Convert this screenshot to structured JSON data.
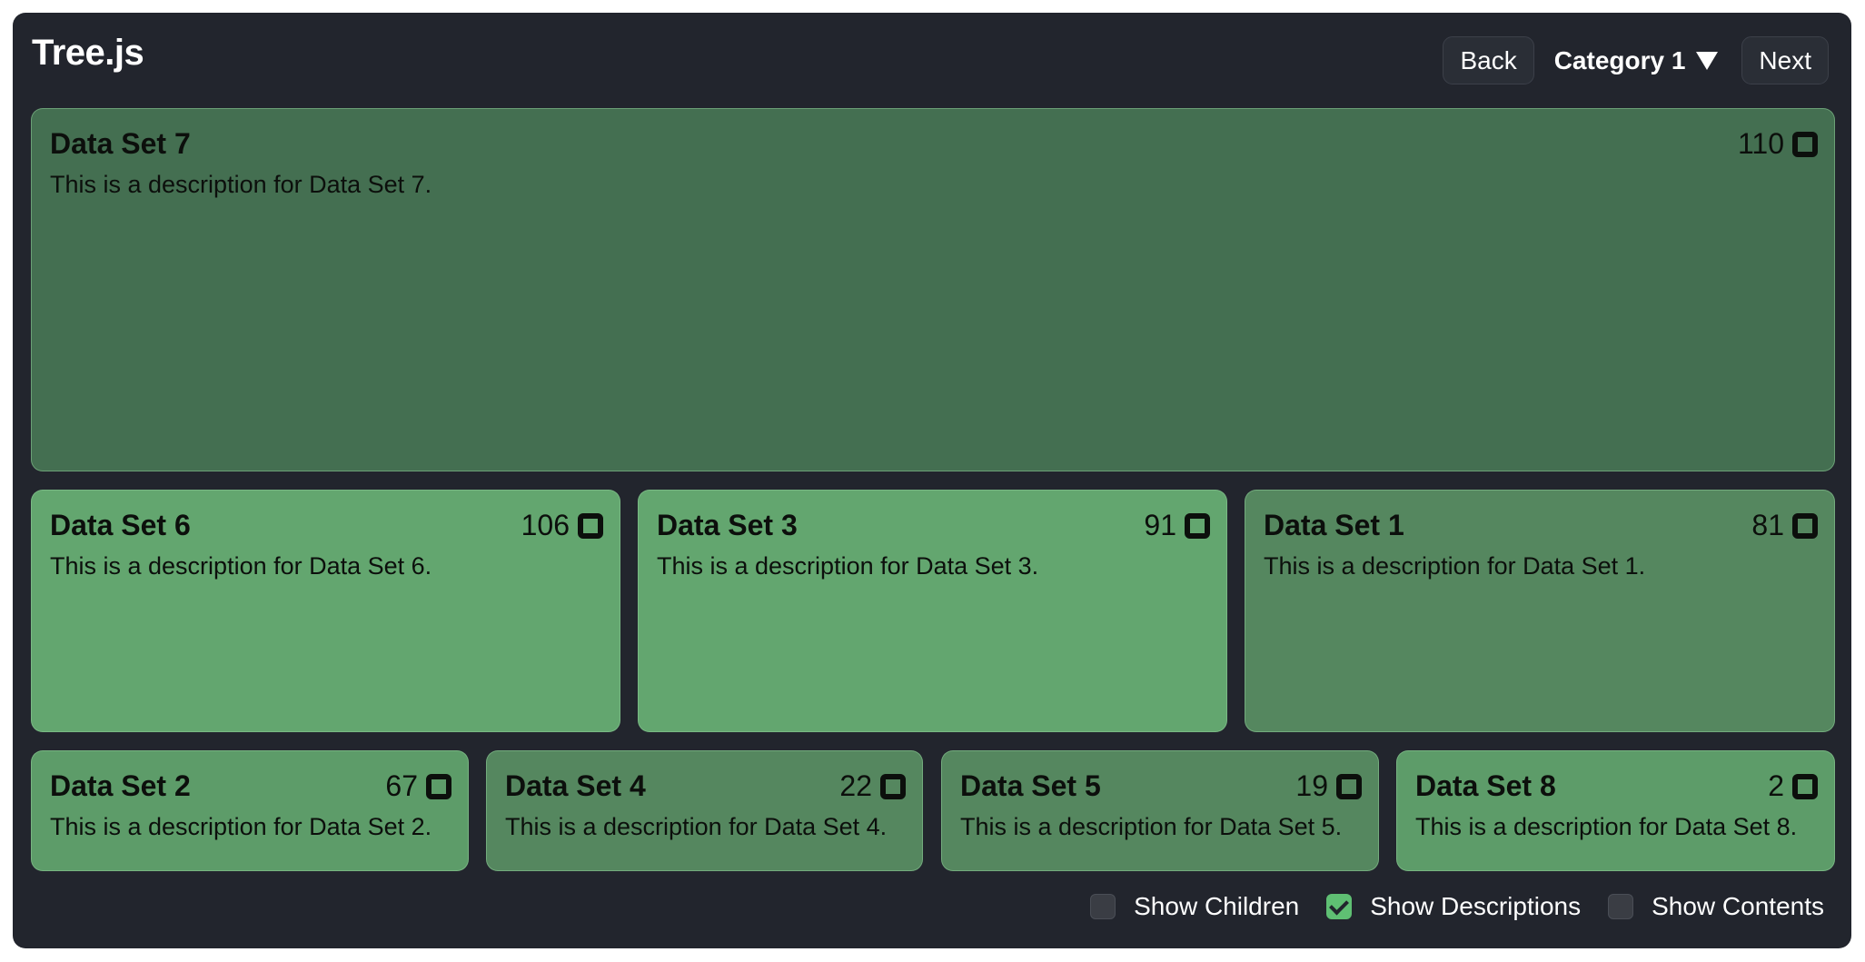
{
  "header": {
    "title": "Tree.js",
    "back_label": "Back",
    "category_label": "Category 1",
    "next_label": "Next"
  },
  "tiles": [
    {
      "title": "Data Set 7",
      "count": "110",
      "description": "This is a description for Data Set 7.",
      "color": "#446f51"
    },
    {
      "title": "Data Set 6",
      "count": "106",
      "description": "This is a description for Data Set 6.",
      "color": "#63a66f"
    },
    {
      "title": "Data Set 3",
      "count": "91",
      "description": "This is a description for Data Set 3.",
      "color": "#63a66f"
    },
    {
      "title": "Data Set 1",
      "count": "81",
      "description": "This is a description for Data Set 1.",
      "color": "#55875f"
    },
    {
      "title": "Data Set 2",
      "count": "67",
      "description": "This is a description for Data Set 2.",
      "color": "#5d9c69"
    },
    {
      "title": "Data Set 4",
      "count": "22",
      "description": "This is a description for Data Set 4.",
      "color": "#55875f"
    },
    {
      "title": "Data Set 5",
      "count": "19",
      "description": "This is a description for Data Set 5.",
      "color": "#55875f"
    },
    {
      "title": "Data Set 8",
      "count": "2",
      "description": "This is a description for Data Set 8.",
      "color": "#5d9c69"
    }
  ],
  "options": {
    "show_children": {
      "label": "Show Children",
      "checked": false
    },
    "show_descriptions": {
      "label": "Show Descriptions",
      "checked": true
    },
    "show_contents": {
      "label": "Show Contents",
      "checked": false
    }
  },
  "colors": {
    "app_background": "#22252d",
    "accent": "#5fbf73"
  }
}
